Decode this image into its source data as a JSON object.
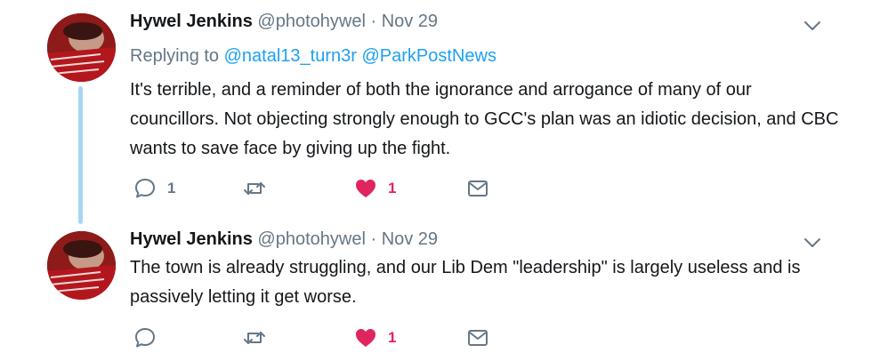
{
  "tweets": [
    {
      "author_name": "Hywel Jenkins",
      "handle": "@photohywel",
      "separator": "·",
      "date": "Nov 29",
      "replying_prefix": "Replying to",
      "replying_to": [
        "@natal13_turn3r",
        "@ParkPostNews"
      ],
      "text": "It's terrible, and a reminder of both the ignorance and arrogance of many of our councillors. Not objecting strongly enough to GCC's plan was an idiotic decision, and CBC wants to save face by giving up the fight.",
      "reply_count": "1",
      "like_count": "1",
      "liked": true
    },
    {
      "author_name": "Hywel Jenkins",
      "handle": "@photohywel",
      "separator": "·",
      "date": "Nov 29",
      "text": "The town is already struggling, and our Lib Dem \"leadership\" is largely useless and is passively letting it get worse.",
      "like_count": "1",
      "liked": true
    }
  ],
  "icons": {
    "reply": "speech-bubble-icon",
    "retweet": "retweet-arrows-icon",
    "like": "heart-icon",
    "dm": "envelope-icon",
    "caret": "chevron-down-icon"
  },
  "colors": {
    "accent": "#1da1f2",
    "like": "#e0245e",
    "muted": "#657786",
    "thread_line": "#a5d7f4"
  }
}
